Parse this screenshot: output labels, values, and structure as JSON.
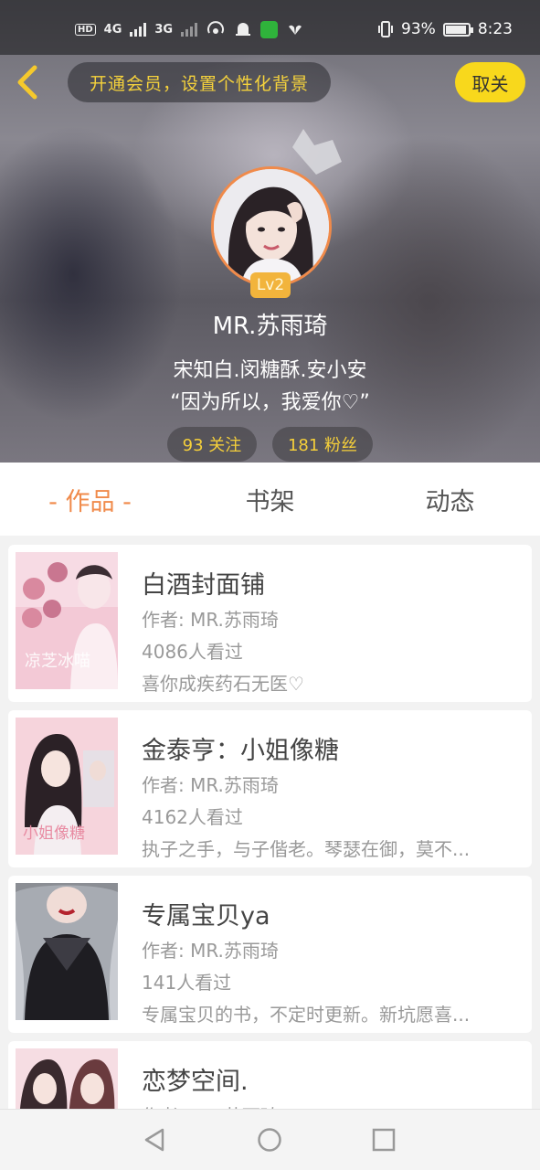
{
  "status_bar": {
    "battery_percent": "93%",
    "time": "8:23",
    "signal_1": "4G",
    "signal_2": "3G",
    "icons": [
      "hd-icon",
      "signal-icon",
      "hotspot-icon",
      "notification-bell-icon",
      "app-notification-icon",
      "huawei-icon",
      "vibrate-icon",
      "battery-icon"
    ]
  },
  "header": {
    "promo_text": "开通会员，设置个性化背景",
    "unfollow_label": "取关",
    "level": "Lv2",
    "username": "MR.苏雨琦",
    "bio_line1": "宋知白.闵糖酥.安小安",
    "bio_line2": "“因为所以，我爱你♡”",
    "following": "93 关注",
    "fans": "181 粉丝",
    "accent_yellow": "#f8d81c",
    "accent_orange": "#f08a4a"
  },
  "tabs": [
    {
      "label": "- 作品 -",
      "active": true
    },
    {
      "label": "书架",
      "active": false
    },
    {
      "label": "动态",
      "active": false
    }
  ],
  "works": [
    {
      "title": "白酒封面铺",
      "author": "作者: MR.苏雨琦",
      "views": "4086人看过",
      "desc": "喜你成疾药石无医♡"
    },
    {
      "title": "金泰亨：小姐像糖",
      "author": "作者: MR.苏雨琦",
      "views": "4162人看过",
      "desc": "执子之手，与子偕老。琴瑟在御，莫不..."
    },
    {
      "title": "专属宝贝ya",
      "author": "作者: MR.苏雨琦",
      "views": "141人看过",
      "desc": "专属宝贝的书，不定时更新。新坑愿喜..."
    },
    {
      "title": "恋梦空间.",
      "author": "作者: MR.苏雨琦",
      "views": "",
      "desc": ""
    }
  ]
}
